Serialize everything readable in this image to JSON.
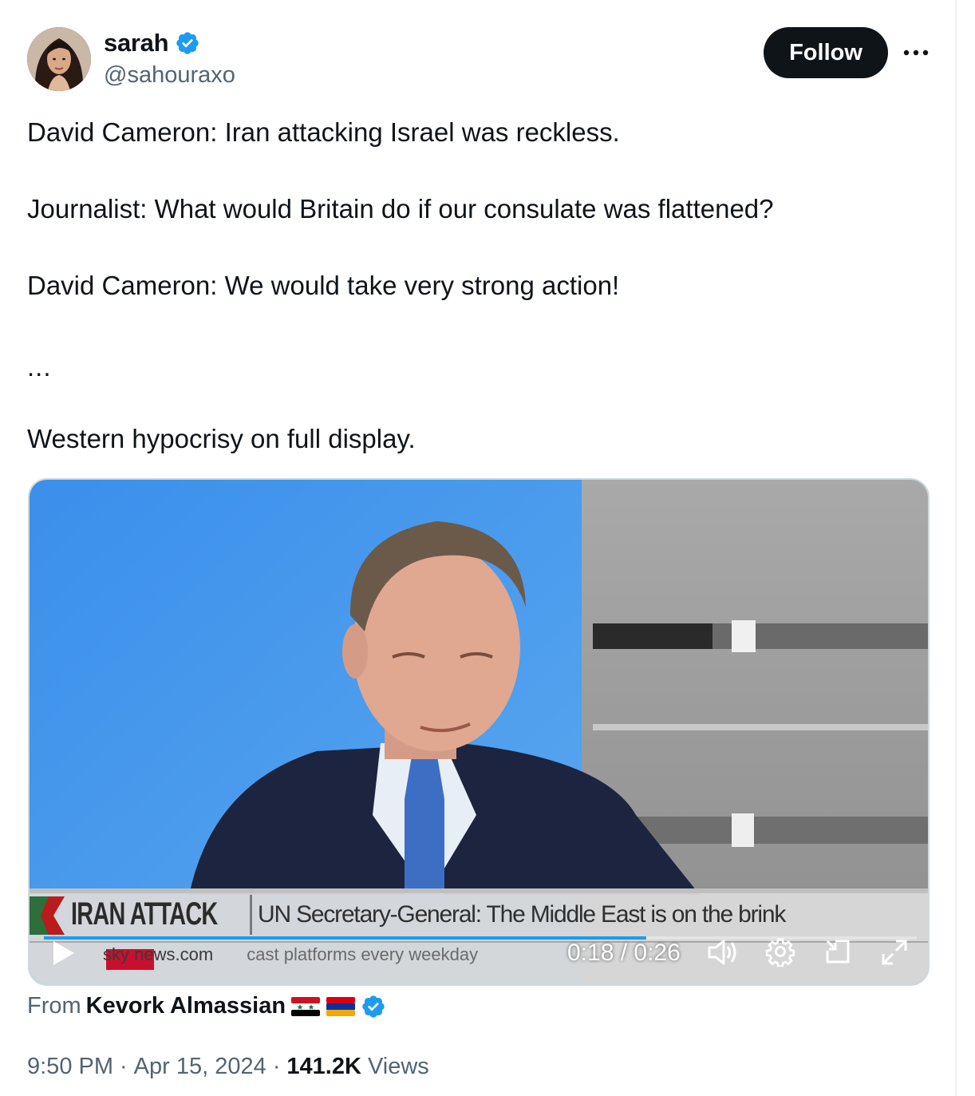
{
  "author": {
    "display_name": "sarah",
    "handle": "@sahouraxo",
    "verified": true,
    "follow_label": "Follow"
  },
  "tweet": {
    "lines": [
      "David Cameron: Iran attacking Israel was reckless.",
      "Journalist: What would Britain do if our consulate was flattened?",
      "David Cameron: We would take very strong action!",
      "...",
      "Western hypocrisy on full display."
    ]
  },
  "video": {
    "chyron_headline": "IRAN ATTACK",
    "chyron_sub": "UN Secretary-General: The Middle East is on the brink",
    "ticker_text": "cast platforms every weekday",
    "brand_text": "sky news.com",
    "current_time": "0:18",
    "duration": "0:26",
    "time_display": "0:18 / 0:26",
    "progress": 0.69
  },
  "source": {
    "from_label": "From",
    "from_name": "Kevork Almassian",
    "flags": [
      "syria-flag",
      "armenia-flag"
    ],
    "verified": true
  },
  "meta": {
    "time": "9:50 PM",
    "separator": "·",
    "date": "Apr 15, 2024",
    "views_count": "141.2K",
    "views_label": "Views"
  },
  "colors": {
    "verified_blue": "#1d9bf0",
    "text_primary": "#0f1419",
    "text_secondary": "#536471",
    "follow_bg": "#0f1419"
  }
}
